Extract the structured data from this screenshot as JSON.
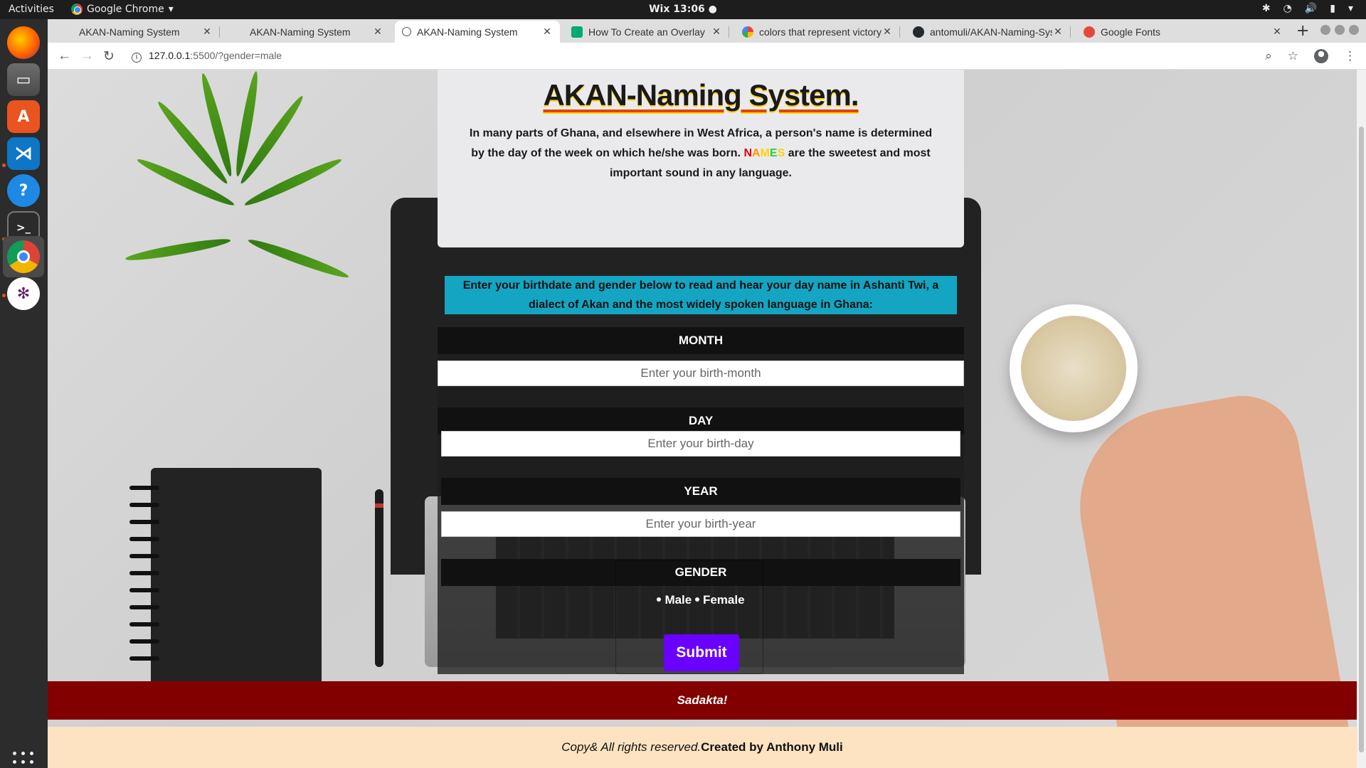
{
  "topbar": {
    "activities": "Activities",
    "app_name": "Google Chrome",
    "clock": "Wix 13:06 ●"
  },
  "tabs": [
    {
      "title": "AKAN-Naming System",
      "icon": "page-icon",
      "active": false
    },
    {
      "title": "AKAN-Naming System",
      "icon": "page-icon",
      "active": false
    },
    {
      "title": "AKAN-Naming System",
      "icon": "globe-icon",
      "active": true
    },
    {
      "title": "How To Create an Overlay",
      "icon": "w3schools-icon",
      "active": false
    },
    {
      "title": "colors that represent victory",
      "icon": "google-icon",
      "active": false
    },
    {
      "title": "antomuli/AKAN-Naming-System",
      "icon": "github-icon",
      "active": false
    },
    {
      "title": "Google Fonts",
      "icon": "google-fonts-icon",
      "active": false
    }
  ],
  "address": {
    "host": "127.0.0.1",
    "rest": ":5500/?gender=male"
  },
  "page": {
    "title": "AKAN-Naming System.",
    "intro_before": "In many parts of Ghana, and elsewhere in West Africa, a person's name is determined by the day of the week on which he/she was born.",
    "names_letters": [
      "N",
      "A",
      "M",
      "E",
      "S"
    ],
    "names_colors": [
      "#e00000",
      "#ff9800",
      "#ffd400",
      "#2ecc40",
      "#ffd400"
    ],
    "intro_after": "are the sweetest and most important sound in any language.",
    "instruction": "Enter your birthdate and gender below to read and hear your day name in Ashanti Twi, a dialect of Akan and the most widely spoken language in Ghana:"
  },
  "form": {
    "month_label": "MONTH",
    "month_placeholder": "Enter your birth-month",
    "day_label": "DAY",
    "day_placeholder": "Enter your birth-day",
    "year_label": "YEAR",
    "year_placeholder": "Enter your birth-year",
    "gender_label": "GENDER",
    "male": "Male",
    "female": "Female",
    "submit": "Submit"
  },
  "banner": "Sadakta!",
  "footer": {
    "copy": "Copy& All rights reserved.",
    "credit": "Created by Anthony Muli"
  },
  "colors": {
    "accent": "#6a00ff",
    "instruction_bg": "#14a5c2",
    "banner_bg": "#820000",
    "footer_bg": "#fde3c2"
  }
}
